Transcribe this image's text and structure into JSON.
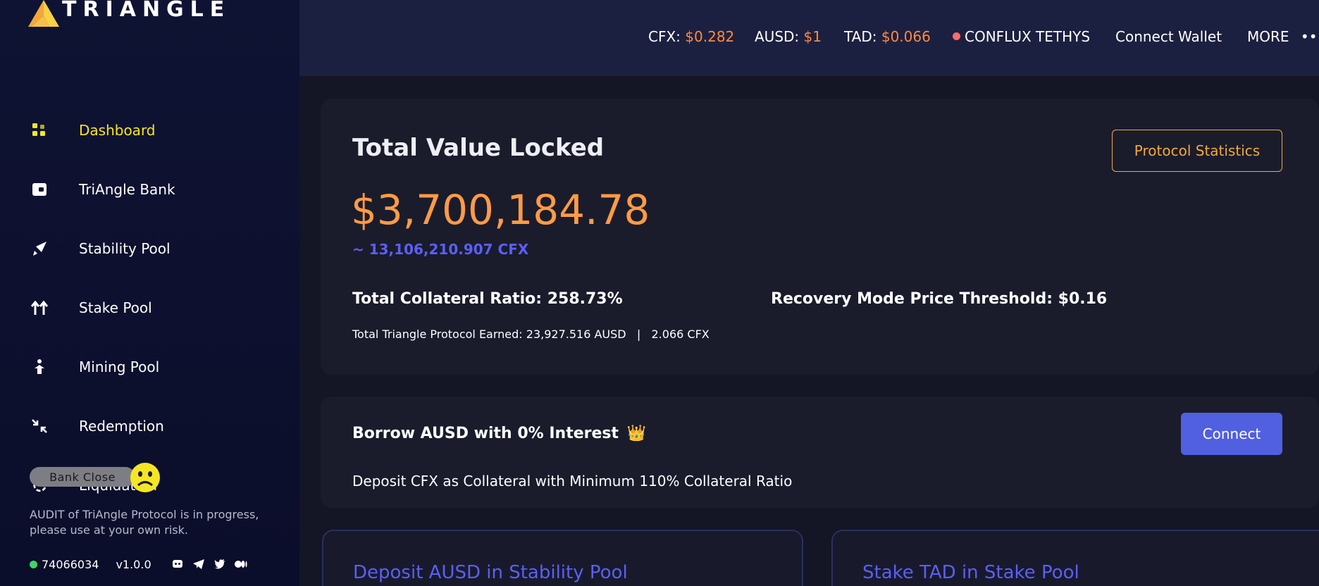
{
  "brand": {
    "name": "TRIANGLE"
  },
  "sidebar": {
    "items": [
      {
        "label": "Dashboard",
        "icon": "dashboard-icon",
        "active": true
      },
      {
        "label": "TriAngle Bank",
        "icon": "bank-icon",
        "active": false
      },
      {
        "label": "Stability Pool",
        "icon": "rocket-icon",
        "active": false
      },
      {
        "label": "Stake Pool",
        "icon": "double-arrow-up-icon",
        "active": false
      },
      {
        "label": "Mining Pool",
        "icon": "miner-icon",
        "active": false
      },
      {
        "label": "Redemption",
        "icon": "arrows-in-icon",
        "active": false
      },
      {
        "label": "Liquidation",
        "icon": "refresh-icon",
        "active": false
      }
    ],
    "bank_close": "Bank Close",
    "audit_notice": "AUDIT of TriAngle Protocol is in progress, please use at your own risk.",
    "block_number": "74066034",
    "version": "v1.0.0",
    "social_icons": [
      "discord-icon",
      "telegram-icon",
      "twitter-icon",
      "medium-icon"
    ]
  },
  "topbar": {
    "cfx_label": "CFX:",
    "cfx_price": "$0.282",
    "ausd_label": "AUSD:",
    "ausd_price": "$1",
    "tad_label": "TAD:",
    "tad_price": "$0.066",
    "network": "CONFLUX TETHYS",
    "connect_wallet": "Connect Wallet",
    "more": "MORE"
  },
  "tvl": {
    "title": "Total Value Locked",
    "value": "$3,700,184.78",
    "cfx_equiv": "~ 13,106,210.907 CFX",
    "collateral_ratio": "Total Collateral Ratio: 258.73%",
    "recovery_threshold": "Recovery Mode Price Threshold: $0.16",
    "earned": "Total Triangle Protocol Earned: 23,927.516 AUSD   |   2.066 CFX",
    "protocol_stats_button": "Protocol Statistics"
  },
  "borrow": {
    "title": "Borrow AUSD with 0% Interest",
    "crown": "👑",
    "description": "Deposit CFX as Collateral with Minimum 110% Collateral Ratio",
    "connect_button": "Connect"
  },
  "pools": {
    "left_title": "Deposit AUSD in Stability Pool",
    "right_title": "Stake TAD in Stake Pool"
  },
  "colors": {
    "accent_yellow": "#f5e625",
    "price_orange": "#ff8a3d",
    "tvl_orange": "#ff9b45",
    "link_blue": "#5b5ff5",
    "button_blue": "#5060e0",
    "network_dot": "#ff6b6b",
    "status_green": "#3ed663"
  }
}
